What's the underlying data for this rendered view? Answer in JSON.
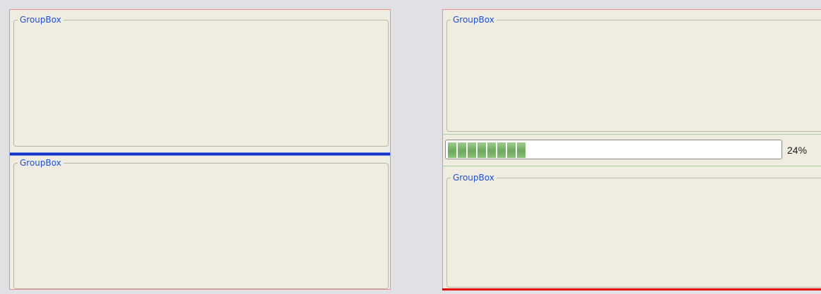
{
  "left_panel": {
    "top_groupbox": {
      "title": "GroupBox"
    },
    "bottom_groupbox": {
      "title": "GroupBox"
    }
  },
  "right_panel": {
    "top_groupbox": {
      "title": "GroupBox"
    },
    "progress": {
      "label": "24%",
      "value": 0.24,
      "color": "#7bb46a"
    },
    "bottom_groupbox": {
      "title": "GroupBox"
    }
  },
  "colors": {
    "splitter": "#1232c8",
    "panel_border": "#f08c8c",
    "active_edge": "#e60000",
    "title_text": "#1f4fd3"
  }
}
